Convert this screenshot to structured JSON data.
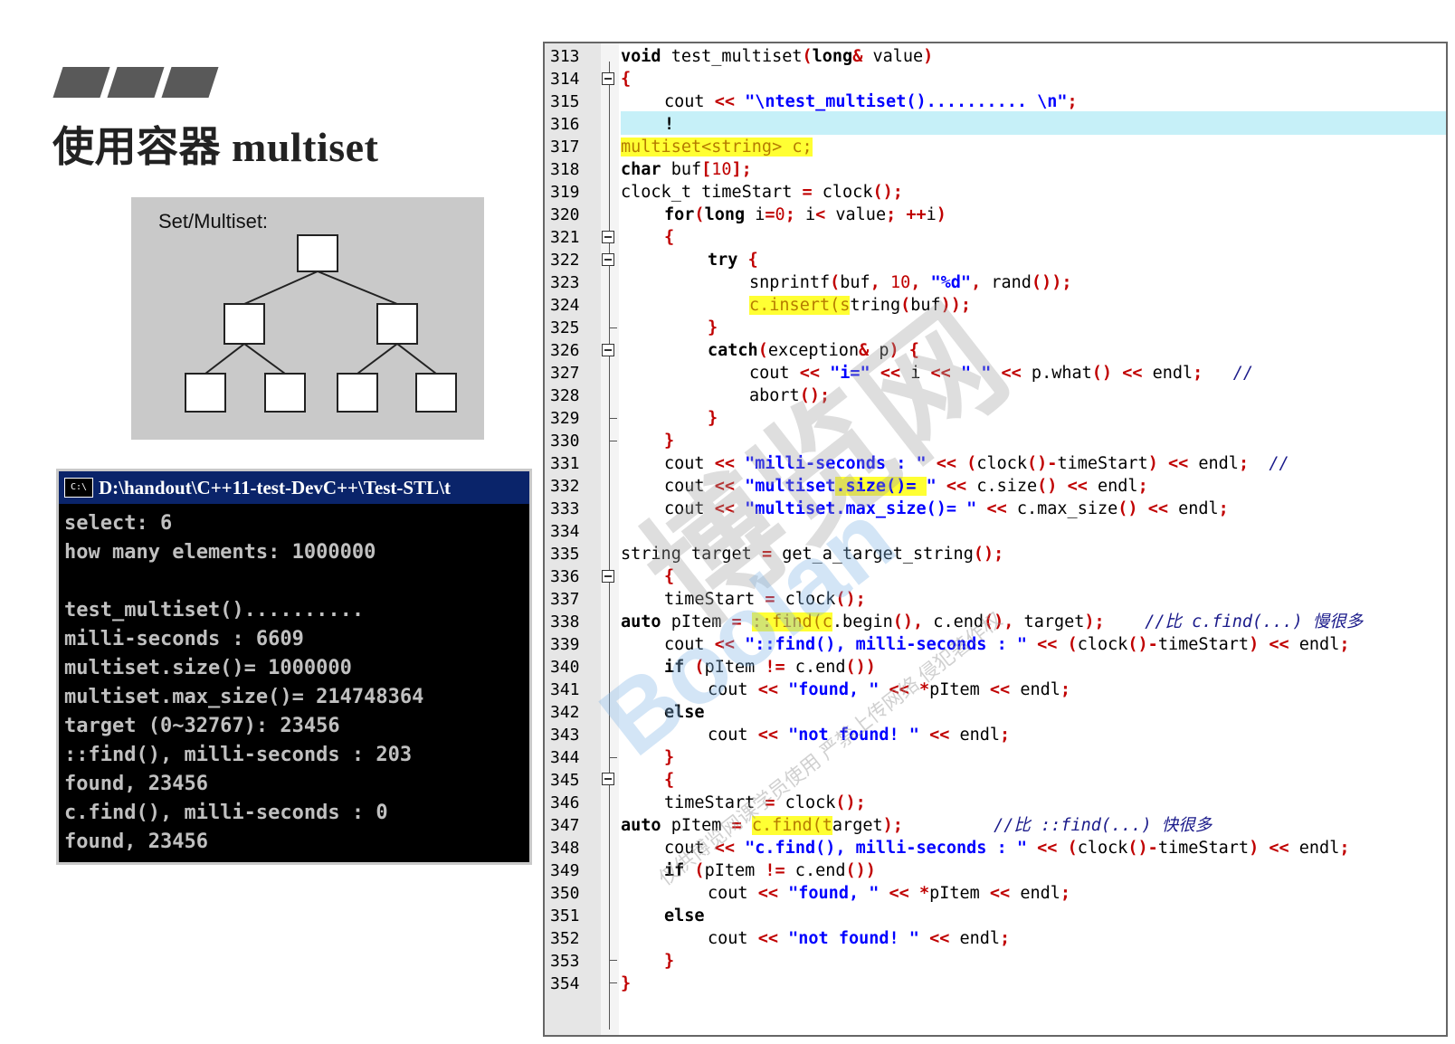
{
  "slide": {
    "title": "使用容器 multiset"
  },
  "diagram": {
    "title": "Set/Multiset:"
  },
  "console": {
    "title": "D:\\handout\\C++11-test-DevC++\\Test-STL\\t",
    "icon": "C:\\",
    "lines": [
      "select: 6",
      "how many elements: 1000000",
      "",
      "test_multiset()..........",
      "milli-seconds : 6609",
      "multiset.size()= 1000000",
      "multiset.max_size()= 214748364",
      "target (0~32767): 23456",
      "::find(), milli-seconds : 203",
      "found, 23456",
      "c.find(), milli-seconds : 0",
      "found, 23456"
    ]
  },
  "editor": {
    "line_numbers": [
      "313",
      "314",
      "315",
      "316",
      "317",
      "318",
      "319",
      "320",
      "321",
      "322",
      "323",
      "324",
      "325",
      "326",
      "327",
      "328",
      "329",
      "330",
      "331",
      "332",
      "333",
      "334",
      "335",
      "336",
      "337",
      "338",
      "339",
      "340",
      "341",
      "342",
      "343",
      "344",
      "345",
      "346",
      "347",
      "348",
      "349",
      "350",
      "351",
      "352",
      "353",
      "354"
    ]
  },
  "watermark": {
    "big": "博览网",
    "brand": "Boolan",
    "small": "仅供博览网课学员使用 严禁上传网络 侵犯著作权"
  },
  "colors": {
    "console_bg": "#000000",
    "console_titlebar": "#0a246a",
    "string": "#0000ff",
    "highlight": "#ffff33",
    "current_line": "#c6f0f8"
  }
}
